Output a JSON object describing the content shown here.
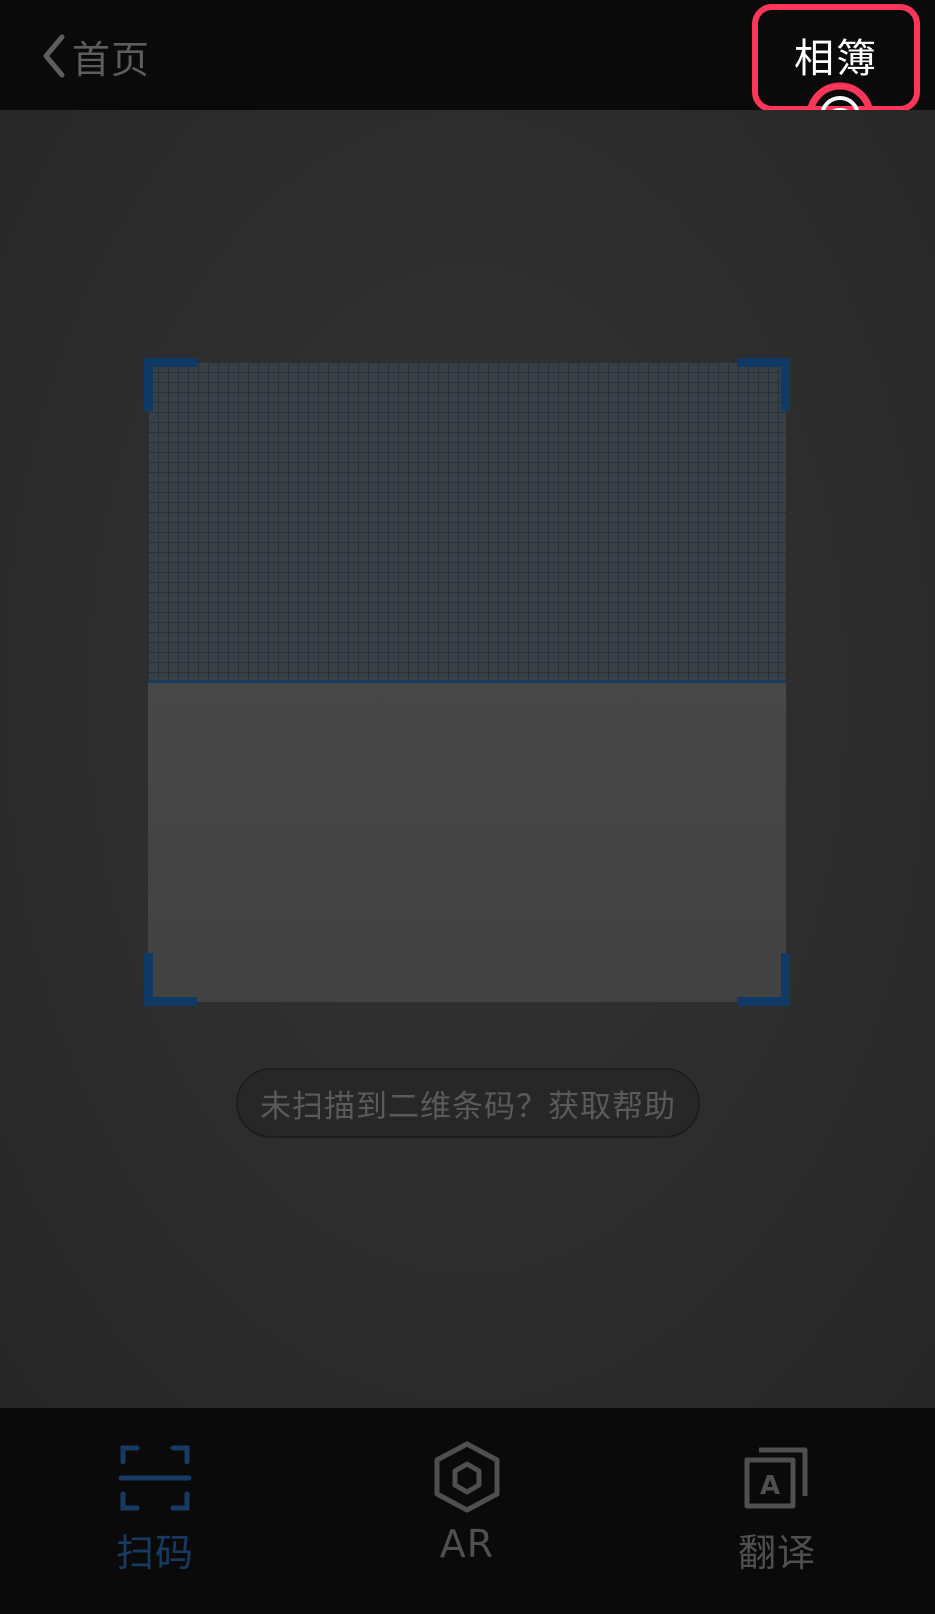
{
  "header": {
    "back_label": "首页",
    "album_label": "相簿"
  },
  "scanner": {
    "help_text": "未扫描到二维条码？获取帮助"
  },
  "tabs": [
    {
      "label": "扫码",
      "icon": "scan-icon",
      "active": true
    },
    {
      "label": "AR",
      "icon": "ar-hexagon-icon",
      "active": false
    },
    {
      "label": "翻译",
      "icon": "translate-icon",
      "active": false
    }
  ],
  "colors": {
    "highlight": "#ff3659",
    "active_tab": "#173a63",
    "inactive_tab": "#4f4f4f"
  }
}
